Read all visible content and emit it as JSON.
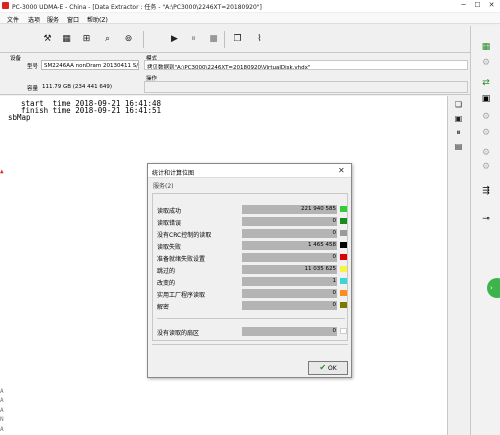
{
  "window": {
    "title": "PC-3000 UDMA-E - China - [Data Extractor : 任务 - \"A:\\PC3000\\2246XT=20180920\"]",
    "minimize": "─",
    "maximize": "☐",
    "close": "✕"
  },
  "menu": {
    "items": [
      "文件",
      "选项",
      "服务",
      "窗口",
      "帮助(Z)"
    ]
  },
  "info": {
    "device_label": "设备",
    "model_label": "型号",
    "model_value": "SM2246AA nonDram 20130411 S/N [0",
    "capacity_label": "容量",
    "capacity_value": "111.79 GB (234 441 649)",
    "mode_label": "模式",
    "mode_value": "拷贝数据到\"A:\\PC3000\\2246XT=20180920\\VirtualDisk.vhdx\"",
    "operation_label": "操作"
  },
  "log": {
    "lines": [
      "  start  time 2018-09-21 16:41:48",
      "  finish time 2018-09-21 16:41:51",
      "sbMap"
    ]
  },
  "dialog": {
    "title": "统计和计算位图",
    "close": "✕",
    "subtitle": "服务(2)",
    "rows": [
      {
        "label": "读取成功",
        "value": "221 940 585",
        "color": "#33cc33"
      },
      {
        "label": "读取错误",
        "value": "0",
        "color": "#1a8a1a"
      },
      {
        "label": "没有CRC控制的读取",
        "value": "0",
        "color": "#9a9a9a"
      },
      {
        "label": "读取失败",
        "value": "1 465 458",
        "color": "#000000"
      },
      {
        "label": "准备就绪失败设置",
        "value": "0",
        "color": "#dd0000"
      },
      {
        "label": "跳过的",
        "value": "11 035 625",
        "color": "#f5f542"
      },
      {
        "label": "改变的",
        "value": "1",
        "color": "#3ad6d6"
      },
      {
        "label": "实用工厂程序读取",
        "value": "0",
        "color": "#ff8c1a"
      },
      {
        "label": "解密",
        "value": "0",
        "color": "#7a7a00"
      }
    ],
    "unread_label": "没有读取的扇区",
    "unread_value": "0",
    "unread_color": "#ffffff",
    "ok_label": "OK"
  },
  "toolbar": {
    "icons": [
      "tools-icon",
      "grid-icon",
      "sector-icon",
      "search-icon",
      "binoculars-icon",
      "play-icon",
      "pause-icon",
      "stop-icon",
      "copy-icon",
      "chart-icon"
    ]
  },
  "side": {
    "left_marks": [
      "A",
      "A",
      "A",
      "N",
      "A"
    ],
    "left_marks_dim": [
      "A"
    ]
  }
}
